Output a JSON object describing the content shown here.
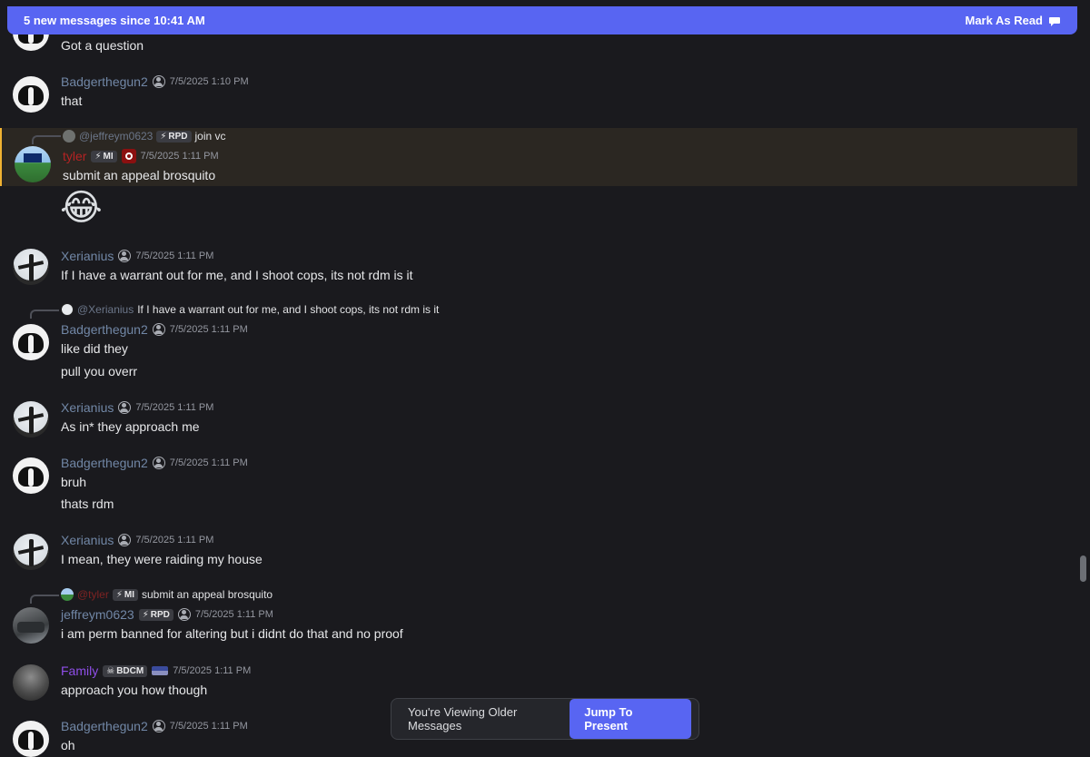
{
  "banner": {
    "text": "5 new messages since 10:41 AM",
    "action_label": "Mark As Read"
  },
  "messages": [
    {
      "id": 0,
      "text": "Got a question"
    },
    {
      "id": 1,
      "username": "Badgerthegun2",
      "timestamp": "7/5/2025 1:10 PM",
      "lines": [
        "that"
      ]
    },
    {
      "id": 2,
      "reply": {
        "username": "@jeffreym0623",
        "tag": "RPD",
        "text": "join vc"
      },
      "username": "tyler",
      "tag": "MI",
      "timestamp": "7/5/2025 1:11 PM",
      "lines": [
        "submit an appeal brosquito"
      ],
      "emoji": "😂",
      "highlighted": true
    },
    {
      "id": 3,
      "username": "Xerianius",
      "timestamp": "7/5/2025 1:11 PM",
      "lines": [
        "If I have a warrant out for me, and I shoot cops, its not rdm is it"
      ]
    },
    {
      "id": 4,
      "reply": {
        "username": "@Xerianius",
        "text": "If I have a warrant out for me, and I shoot cops, its not rdm is it"
      },
      "username": "Badgerthegun2",
      "timestamp": "7/5/2025 1:11 PM",
      "lines": [
        "like did they",
        "pull you overr"
      ]
    },
    {
      "id": 5,
      "username": "Xerianius",
      "timestamp": "7/5/2025 1:11 PM",
      "lines": [
        "As in* they approach me"
      ]
    },
    {
      "id": 6,
      "username": "Badgerthegun2",
      "timestamp": "7/5/2025 1:11 PM",
      "lines": [
        "bruh",
        "thats rdm"
      ]
    },
    {
      "id": 7,
      "username": "Xerianius",
      "timestamp": "7/5/2025 1:11 PM",
      "lines": [
        "I mean, they were raiding my house"
      ]
    },
    {
      "id": 8,
      "reply": {
        "username": "@tyler",
        "tag": "MI",
        "text": "submit an appeal brosquito"
      },
      "username": "jeffreym0623",
      "tag": "RPD",
      "timestamp": "7/5/2025 1:11 PM",
      "lines": [
        "i am perm banned for altering but i didnt do that and no proof"
      ]
    },
    {
      "id": 9,
      "username": "Family",
      "tag": "BDCM",
      "timestamp": "7/5/2025 1:11 PM",
      "lines": [
        "approach you how though"
      ]
    },
    {
      "id": 10,
      "username": "Badgerthegun2",
      "timestamp": "7/5/2025 1:11 PM",
      "lines": [
        "oh"
      ]
    }
  ],
  "older_bar": {
    "text": "You're Viewing Older Messages",
    "button_label": "Jump To Present"
  },
  "colors": {
    "accent": "#5865f2",
    "background": "#1a1a1e",
    "username_default": "#7187a6",
    "username_tyler": "#b52323",
    "username_family": "#8f4ee8",
    "highlight_bar": "#f0b232"
  }
}
